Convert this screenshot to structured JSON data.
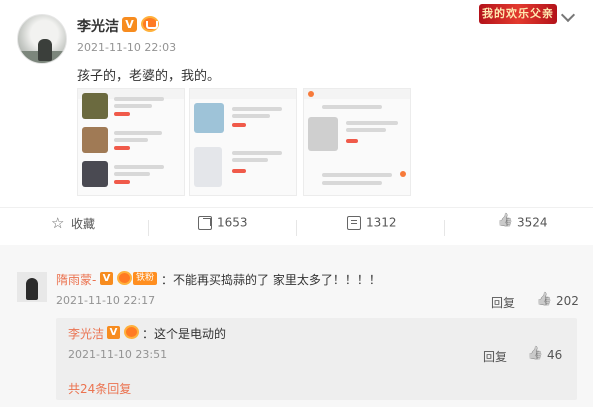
{
  "post": {
    "author": "李光洁",
    "verified_badge": "V",
    "timestamp": "2021-11-10 22:03",
    "text": "孩子的，老婆的，我的。",
    "topic_badge": "我的欢乐父亲",
    "images": [
      "product-listing-1",
      "product-listing-2",
      "product-listing-3"
    ]
  },
  "actions": {
    "favorite_label": "收藏",
    "share_count": "1653",
    "comment_count": "1312",
    "like_count": "3524"
  },
  "comments": [
    {
      "author": "隋雨蒙-",
      "verified_badge": "V",
      "fan_badge": "铁粉",
      "text": "：不能再买捣蒜的了 家里太多了！！！！",
      "timestamp": "2021-11-10 22:17",
      "reply_label": "回复",
      "like_count": "202",
      "replies": [
        {
          "author": "李光洁",
          "verified_badge": "V",
          "text": "：这个是电动的",
          "timestamp": "2021-11-10 23:51",
          "reply_label": "回复",
          "like_count": "46"
        }
      ],
      "more_replies_label": "共24条回复"
    }
  ],
  "colors": {
    "name_accent": "#eb7350",
    "vip_orange": "#f78c1f",
    "text_gray": "#939393"
  }
}
